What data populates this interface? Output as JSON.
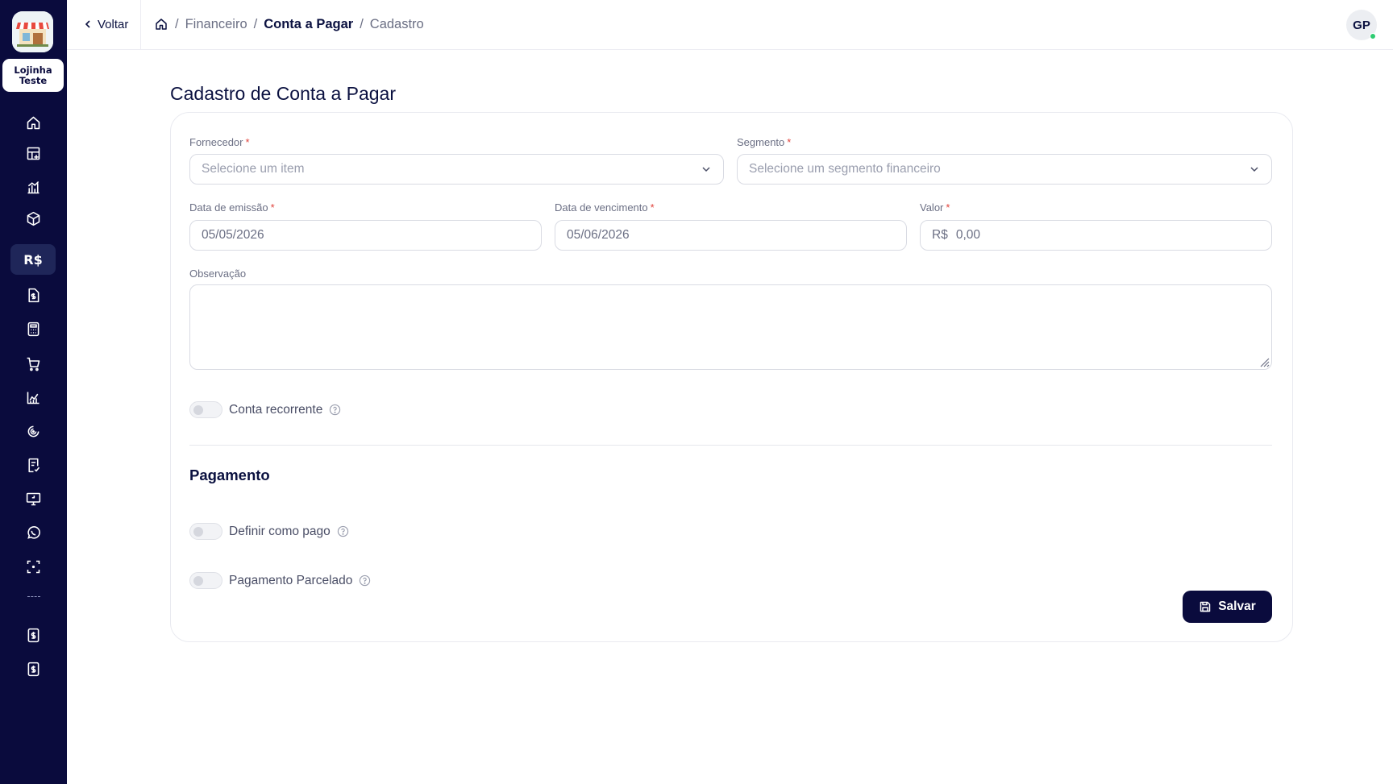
{
  "sidebar": {
    "store_name_line1": "Lojinha",
    "store_name_line2": "Teste",
    "active_item_label": "R$",
    "items": [
      "home-icon",
      "dashboard-icon",
      "stats-icon",
      "box-icon",
      "money-icon",
      "invoice-icon",
      "calculator-icon",
      "cart-icon",
      "chart-icon",
      "target-icon",
      "receipt-icon",
      "monitor-icon",
      "whatsapp-icon",
      "scan-icon",
      "dollar-doc-icon",
      "dollar-doc-alt-icon"
    ]
  },
  "topbar": {
    "back_label": "Voltar",
    "breadcrumb": [
      "Financeiro",
      "Conta a Pagar",
      "Cadastro"
    ],
    "avatar_initials": "GP"
  },
  "page": {
    "title": "Cadastro de Conta a Pagar"
  },
  "form": {
    "fornecedor": {
      "label": "Fornecedor",
      "placeholder": "Selecione um item"
    },
    "segmento": {
      "label": "Segmento",
      "placeholder": "Selecione um segmento financeiro"
    },
    "data_emissao": {
      "label": "Data de emissão",
      "value": "05/05/2026"
    },
    "data_vencimento": {
      "label": "Data de vencimento",
      "value": "05/06/2026"
    },
    "valor": {
      "label": "Valor",
      "prefix": "R$",
      "value": "0,00"
    },
    "observacao": {
      "label": "Observação",
      "value": ""
    },
    "conta_recorrente": {
      "label": "Conta recorrente",
      "checked": false
    },
    "required_mark": "*"
  },
  "pagamento": {
    "title": "Pagamento",
    "definir_pago": {
      "label": "Definir como pago",
      "checked": false
    },
    "parcelado": {
      "label": "Pagamento Parcelado",
      "checked": false
    }
  },
  "actions": {
    "save_label": "Salvar"
  },
  "colors": {
    "sidebar_bg": "#0a0b3d",
    "primary": "#0a0b3d",
    "required": "#e0443d",
    "online": "#2ecc71"
  }
}
